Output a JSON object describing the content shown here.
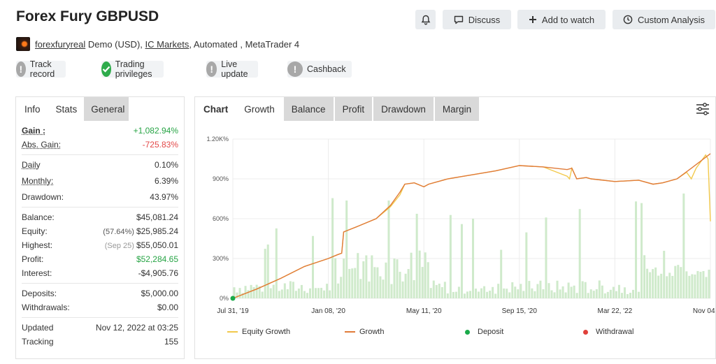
{
  "header": {
    "title": "Forex Fury GBPUSD",
    "buttons": {
      "bell_label": "",
      "discuss": "Discuss",
      "watch": "Add to watch",
      "analysis": "Custom Analysis"
    }
  },
  "meta": {
    "user": "forexfuryreal",
    "account": "Demo (USD),",
    "broker": "IC Markets",
    "rest": ", Automated , MetaTrader 4"
  },
  "badges": {
    "track": "Track record",
    "trading": "Trading privileges",
    "live": "Live update",
    "cashback": "Cashback"
  },
  "left_tabs": {
    "info": "Info",
    "stats": "Stats",
    "general": "General"
  },
  "stats": {
    "gain_label": "Gain :",
    "gain_value": "+1,082.94%",
    "abs_label": "Abs. Gain:",
    "abs_value": "-725.83%",
    "daily_label": "Daily",
    "daily_value": "0.10%",
    "monthly_label": "Monthly:",
    "monthly_value": "6.39%",
    "drawdown_label": "Drawdown:",
    "drawdown_value": "43.97%",
    "balance_label": "Balance:",
    "balance_value": "$45,081.24",
    "equity_label": "Equity:",
    "equity_note": "(57.64%)",
    "equity_value": "$25,985.24",
    "highest_label": "Highest:",
    "highest_note": "(Sep 25)",
    "highest_value": "$55,050.01",
    "profit_label": "Profit:",
    "profit_value": "$52,284.65",
    "interest_label": "Interest:",
    "interest_value": "-$4,905.76",
    "deposits_label": "Deposits:",
    "deposits_value": "$5,000.00",
    "withdrawals_label": "Withdrawals:",
    "withdrawals_value": "$0.00",
    "updated_label": "Updated",
    "updated_value": "Nov 12, 2022 at 03:25",
    "tracking_label": "Tracking",
    "tracking_value": "155"
  },
  "chart_tabs": {
    "chart": "Chart",
    "growth": "Growth",
    "balance": "Balance",
    "profit": "Profit",
    "drawdown": "Drawdown",
    "margin": "Margin"
  },
  "colors": {
    "growth": "#e07b39",
    "equity": "#f2c94c",
    "bars": "#cfeacb",
    "deposit": "#1aaa4a",
    "withdrawal": "#e0403a"
  },
  "chart_data": {
    "type": "line",
    "y_tick_labels": [
      "0%",
      "300%",
      "600%",
      "900%",
      "1.20K%"
    ],
    "ylim": [
      0,
      1200
    ],
    "x_tick_labels": [
      "Jul 31, '19",
      "Jan 08, '20",
      "May 11, '20",
      "Sep 15, '20",
      "Mar 22, '22",
      "Nov 04, '22"
    ],
    "legend": [
      "Equity Growth",
      "Growth",
      "Deposit",
      "Withdrawal"
    ],
    "legend_position": "bottom",
    "grid": true,
    "series": [
      {
        "name": "Growth",
        "x": [
          0,
          0.05,
          0.1,
          0.15,
          0.2,
          0.22,
          0.228,
          0.232,
          0.26,
          0.3,
          0.33,
          0.35,
          0.36,
          0.38,
          0.4,
          0.41,
          0.45,
          0.5,
          0.55,
          0.6,
          0.65,
          0.7,
          0.71,
          0.72,
          0.74,
          0.75,
          0.8,
          0.85,
          0.88,
          0.9,
          0.93,
          0.96,
          1.0
        ],
        "y": [
          0,
          70,
          150,
          240,
          300,
          330,
          340,
          500,
          540,
          600,
          700,
          800,
          860,
          870,
          840,
          860,
          900,
          930,
          960,
          1000,
          990,
          970,
          980,
          900,
          910,
          900,
          880,
          890,
          860,
          870,
          900,
          980,
          1090
        ]
      },
      {
        "name": "Equity Growth",
        "x": [
          0,
          0.05,
          0.1,
          0.15,
          0.2,
          0.22,
          0.228,
          0.232,
          0.26,
          0.3,
          0.33,
          0.35,
          0.36,
          0.38,
          0.4,
          0.41,
          0.45,
          0.5,
          0.55,
          0.6,
          0.65,
          0.7,
          0.705,
          0.71,
          0.72,
          0.74,
          0.75,
          0.8,
          0.85,
          0.88,
          0.9,
          0.93,
          0.95,
          0.96,
          0.97,
          0.99,
          0.995,
          1.0
        ],
        "y": [
          0,
          70,
          150,
          240,
          300,
          330,
          340,
          500,
          540,
          600,
          690,
          780,
          860,
          870,
          840,
          860,
          900,
          930,
          960,
          1000,
          990,
          920,
          900,
          980,
          900,
          910,
          900,
          880,
          890,
          860,
          870,
          900,
          950,
          900,
          980,
          1080,
          1050,
          580
        ]
      }
    ],
    "deposit": {
      "x": 0,
      "y": 0
    }
  }
}
